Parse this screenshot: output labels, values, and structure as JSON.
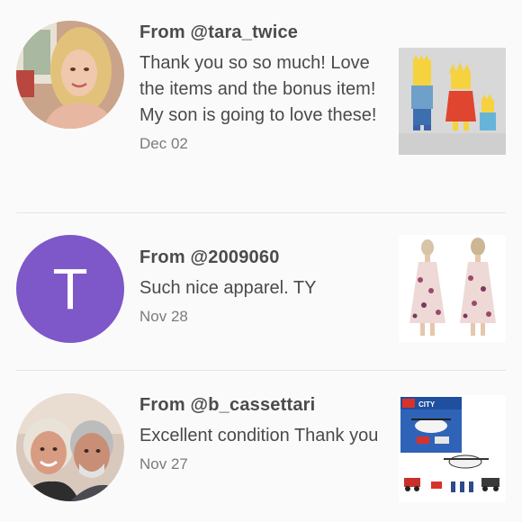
{
  "reviews": [
    {
      "from": "From @tara_twice",
      "message": "Thank you so so much! Love the items and the bonus item! My son is going to love these!",
      "date": "Dec 02",
      "avatar_type": "photo",
      "item_image": "simpsons-figures"
    },
    {
      "from": "From @2009060",
      "message": "Such nice apparel. TY",
      "date": "Nov 28",
      "avatar_type": "letter",
      "avatar_letter": "T",
      "avatar_color": "#7e57c8",
      "item_image": "floral-dress"
    },
    {
      "from": "From @b_cassettari",
      "message": "Excellent condition Thank you",
      "date": "Nov 27",
      "avatar_type": "photo",
      "item_image": "lego-city-set",
      "item_brand": "CITY"
    }
  ]
}
